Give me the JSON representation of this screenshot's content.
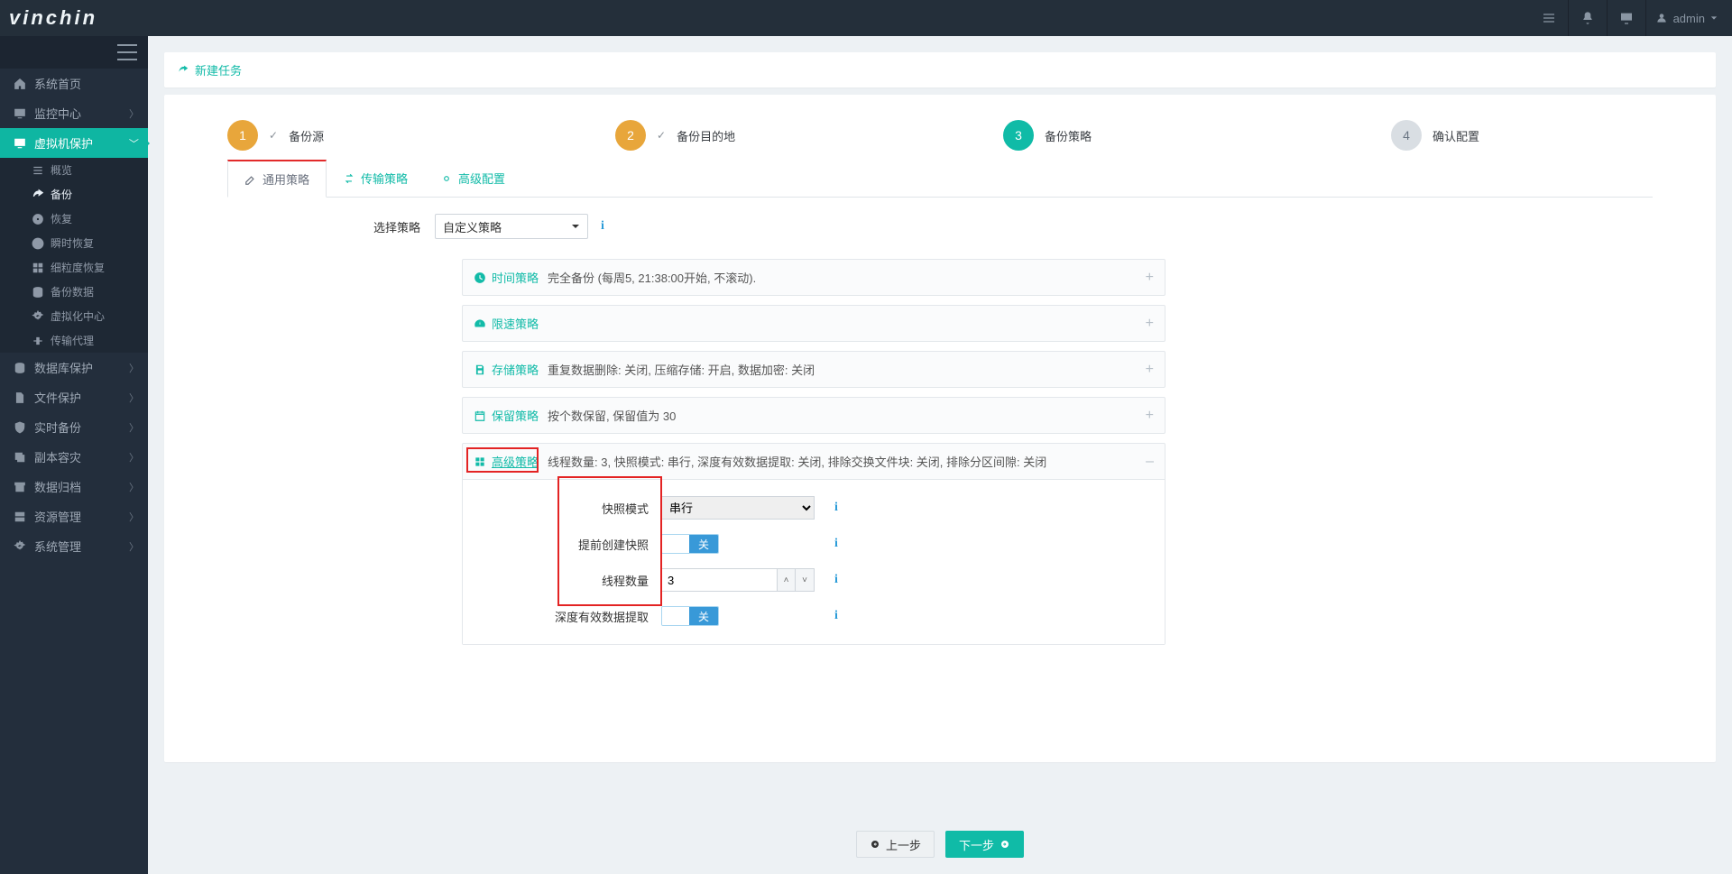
{
  "brand": "vinchin",
  "header": {
    "user": "admin"
  },
  "sidebar": {
    "items": [
      {
        "label": "系统首页",
        "icon": "home"
      },
      {
        "label": "监控中心",
        "icon": "monitor",
        "chev": true
      },
      {
        "label": "虚拟机保护",
        "icon": "monitor",
        "chev": true,
        "active": true,
        "sub": [
          {
            "label": "概览",
            "icon": "bars"
          },
          {
            "label": "备份",
            "icon": "share",
            "active": true
          },
          {
            "label": "恢复",
            "icon": "disk"
          },
          {
            "label": "瞬时恢复",
            "icon": "clock"
          },
          {
            "label": "细粒度恢复",
            "icon": "gran"
          },
          {
            "label": "备份数据",
            "icon": "db"
          },
          {
            "label": "虚拟化中心",
            "icon": "gear"
          },
          {
            "label": "传输代理",
            "icon": "proxy"
          }
        ]
      },
      {
        "label": "数据库保护",
        "icon": "db",
        "chev": true
      },
      {
        "label": "文件保护",
        "icon": "file",
        "chev": true
      },
      {
        "label": "实时备份",
        "icon": "shield",
        "chev": true
      },
      {
        "label": "副本容灾",
        "icon": "copy",
        "chev": true
      },
      {
        "label": "数据归档",
        "icon": "archive",
        "chev": true
      },
      {
        "label": "资源管理",
        "icon": "res",
        "chev": true
      },
      {
        "label": "系统管理",
        "icon": "gear",
        "chev": true
      }
    ]
  },
  "page": {
    "title": "新建任务"
  },
  "steps": [
    {
      "num": "1",
      "label": "备份源",
      "done": true,
      "cls": "c-orange"
    },
    {
      "num": "2",
      "label": "备份目的地",
      "done": true,
      "cls": "c-orange"
    },
    {
      "num": "3",
      "label": "备份策略",
      "done": false,
      "cls": "c-teal"
    },
    {
      "num": "4",
      "label": "确认配置",
      "done": false,
      "cls": "c-grey"
    }
  ],
  "inner_tabs": [
    {
      "label": "通用策略",
      "active": true,
      "icon": "pencil"
    },
    {
      "label": "传输策略",
      "icon": "swap"
    },
    {
      "label": "高级配置",
      "icon": "gear"
    }
  ],
  "select_policy": {
    "label": "选择策略",
    "value": "自定义策略"
  },
  "accordions": {
    "time": {
      "title": "时间策略",
      "summary": "完全备份 (每周5, 21:38:00开始, 不滚动)."
    },
    "speed": {
      "title": "限速策略",
      "summary": ""
    },
    "store": {
      "title": "存储策略",
      "summary": "重复数据删除: 关闭, 压缩存储: 开启, 数据加密: 关闭"
    },
    "retain": {
      "title": "保留策略",
      "summary": "按个数保留, 保留值为 30"
    },
    "adv": {
      "title": "高级策略",
      "summary": "线程数量: 3, 快照模式: 串行, 深度有效数据提取: 关闭, 排除交换文件块: 关闭, 排除分区间隙: 关闭"
    }
  },
  "adv_form": {
    "snapshot_mode": {
      "label": "快照模式",
      "value": "串行"
    },
    "precreate": {
      "label": "提前创建快照",
      "value": "关"
    },
    "threads": {
      "label": "线程数量",
      "value": "3"
    },
    "deep": {
      "label": "深度有效数据提取",
      "value": "关"
    }
  },
  "buttons": {
    "prev": "上一步",
    "next": "下一步"
  }
}
